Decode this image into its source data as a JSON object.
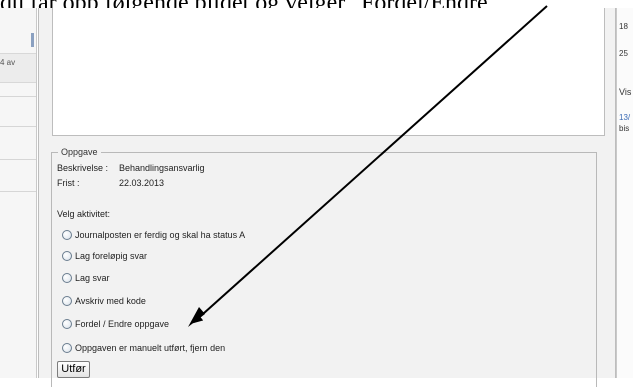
{
  "document": {
    "text": "du får opp følgende bildet og velger \"Fordel/Endre"
  },
  "left_panel": {
    "label": "4 av"
  },
  "right_panel": {
    "items": [
      "18",
      "25",
      "Vis",
      "13/",
      "bis"
    ]
  },
  "task": {
    "legend": "Oppgave",
    "description_label": "Beskrivelse :",
    "description_value": "Behandlingsansvarlig",
    "deadline_label": "Frist :",
    "deadline_value": "22.03.2013",
    "activity_label": "Velg aktivitet:",
    "options": [
      "Journalposten er ferdig og skal ha status A",
      "Lag foreløpig svar",
      "Lag svar",
      "Avskriv med kode",
      "Fordel / Endre oppgave",
      "Oppgaven er manuelt utført, fjern den"
    ],
    "submit_label": "Utfør"
  },
  "colors": {
    "dialog_bg": "#f2f2f2",
    "border": "#bdbdbd",
    "link": "#3b6bb5",
    "arrow": "#000000"
  }
}
